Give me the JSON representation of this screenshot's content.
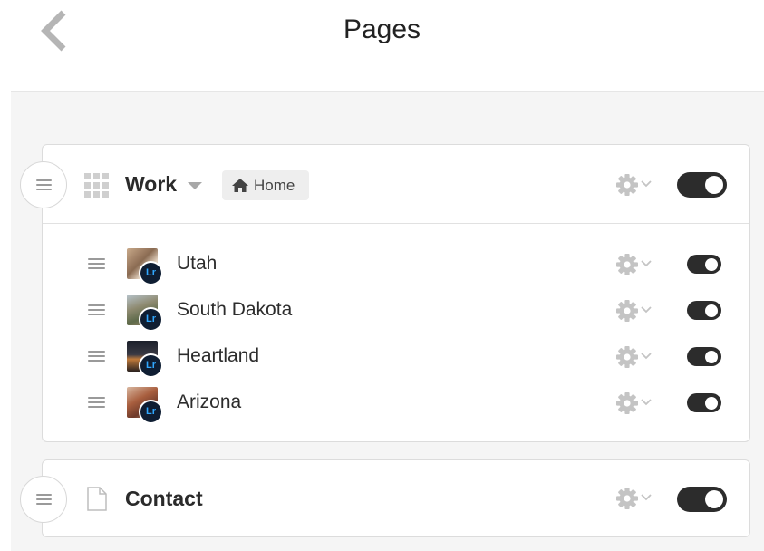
{
  "header": {
    "title": "Pages"
  },
  "work": {
    "title": "Work",
    "badge": "Home",
    "toggle_on": true,
    "items": [
      {
        "label": "Utah",
        "badge": "Lr",
        "toggle_on": true
      },
      {
        "label": "South Dakota",
        "badge": "Lr",
        "toggle_on": true
      },
      {
        "label": "Heartland",
        "badge": "Lr",
        "toggle_on": true
      },
      {
        "label": "Arizona",
        "badge": "Lr",
        "toggle_on": true
      }
    ]
  },
  "contact": {
    "title": "Contact",
    "toggle_on": true
  },
  "icons": {
    "back": "chevron-left-icon",
    "drag": "drag-handle-icon",
    "grid": "grid-icon",
    "page": "document-icon",
    "home": "home-icon",
    "settings": "gear-icon",
    "dropdown": "caret-down-icon",
    "app_badge": "lightroom-icon"
  },
  "colors": {
    "toggle_on": "#2c2c2c",
    "lightroom_bg": "#0f1e33",
    "lightroom_text": "#31a8ff",
    "content_bg": "#f5f5f5"
  }
}
